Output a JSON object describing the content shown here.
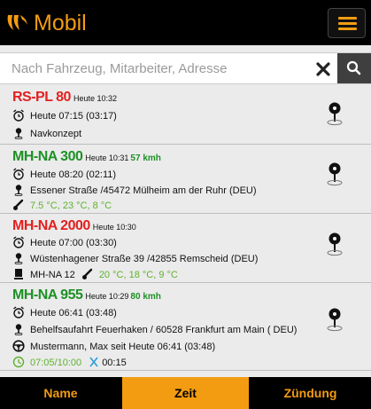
{
  "header": {
    "title": "Mobil"
  },
  "search": {
    "placeholder": "Nach Fahrzeug, Mitarbeiter, Adresse"
  },
  "vehicles": [
    {
      "plate": "RS-PL 80",
      "stamp": "Heute 10:32",
      "time": "Heute 07:15 (03:17)",
      "address": "Navkonzept"
    },
    {
      "plate": "MH-NA 300",
      "stamp": "Heute 10:31",
      "speed": "57 kmh",
      "time": "Heute 08:20 (02:11)",
      "address": "Essener Straße /45472 Mülheim am der Ruhr  (DEU)",
      "temps": [
        "7.5 °C",
        "23 °C",
        "8 °C"
      ]
    },
    {
      "plate": "MH-NA 2000",
      "stamp": "Heute 10:30",
      "time": "Heute 07:00 (03:30)",
      "address": "Wüstenhagener Straße 39 /42855 Remscheid  (DEU)",
      "trailer": "MH-NA 12",
      "temps": [
        "20 °C",
        "18 °C",
        "9 °C"
      ]
    },
    {
      "plate": "MH-NA 955",
      "stamp": "Heute 10:29",
      "speed": "80 kmh",
      "time": "Heute 06:41 (03:48)",
      "address": "Behelfsaufahrt Feuerhaken / 60528 Frankfurt am Main ( DEU)",
      "driver": "Mustermann,  Max seit Heute 06:41 (03:48)",
      "work_time": "07:05/10:00",
      "pause_time": "00:15"
    }
  ],
  "tabs": [
    {
      "label": "Name"
    },
    {
      "label": "Zeit"
    },
    {
      "label": "Zündung"
    }
  ],
  "colors": {
    "accent": "#f39c12",
    "plate_red": "#e32020",
    "plate_green": "#1d9125",
    "temperature": "#5fb12e"
  }
}
